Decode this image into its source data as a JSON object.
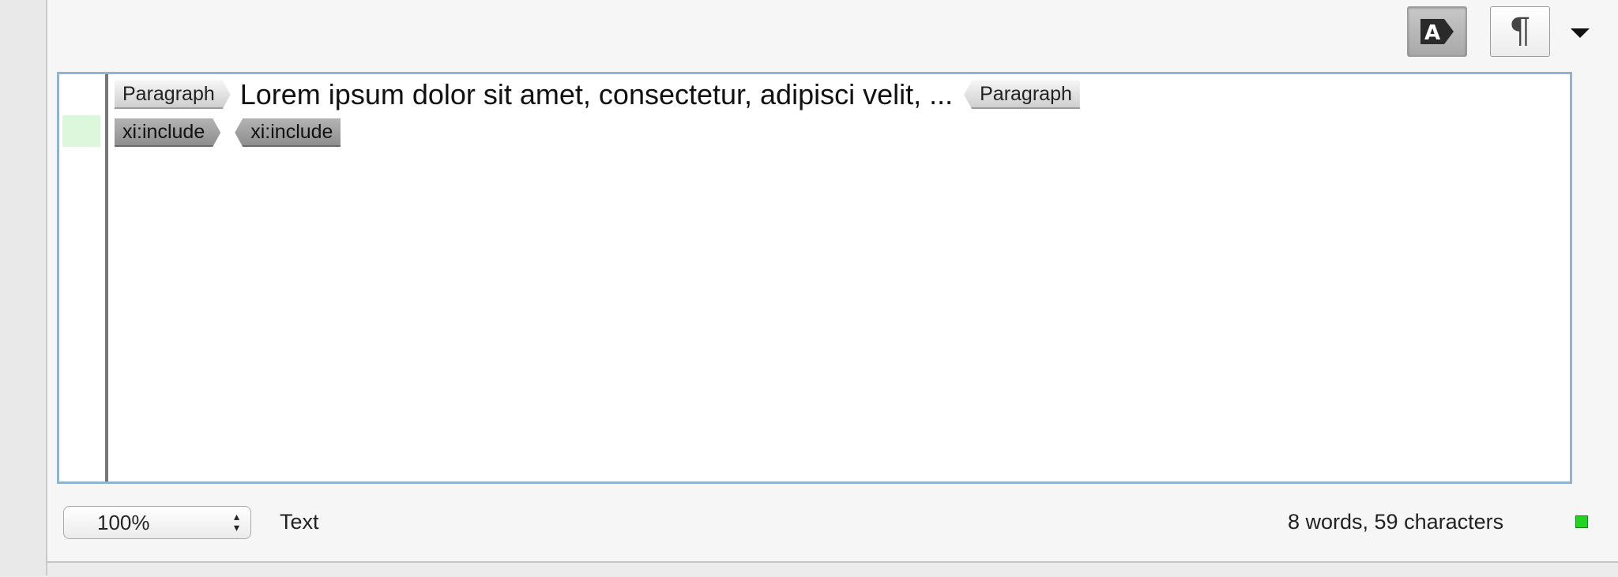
{
  "toolbar": {
    "tags_toggle_label": "A",
    "paragraph_toggle_label": "¶",
    "options_menu": "chevron-down-icon"
  },
  "editor": {
    "line1": {
      "open_tag": "Paragraph",
      "text": "Lorem ipsum dolor sit amet, consectetur, adipisci velit, ...",
      "close_tag": "Paragraph"
    },
    "line2": {
      "open_tag": "xi:include",
      "close_tag": "xi:include"
    }
  },
  "status_bar": {
    "zoom": "100%",
    "mode": "Text",
    "word_count": "8 words, 59 characters",
    "status_color": "#22d322"
  },
  "colors": {
    "editor_border": "#8fb4d2",
    "gutter_highlight": "#dcf7dc"
  }
}
